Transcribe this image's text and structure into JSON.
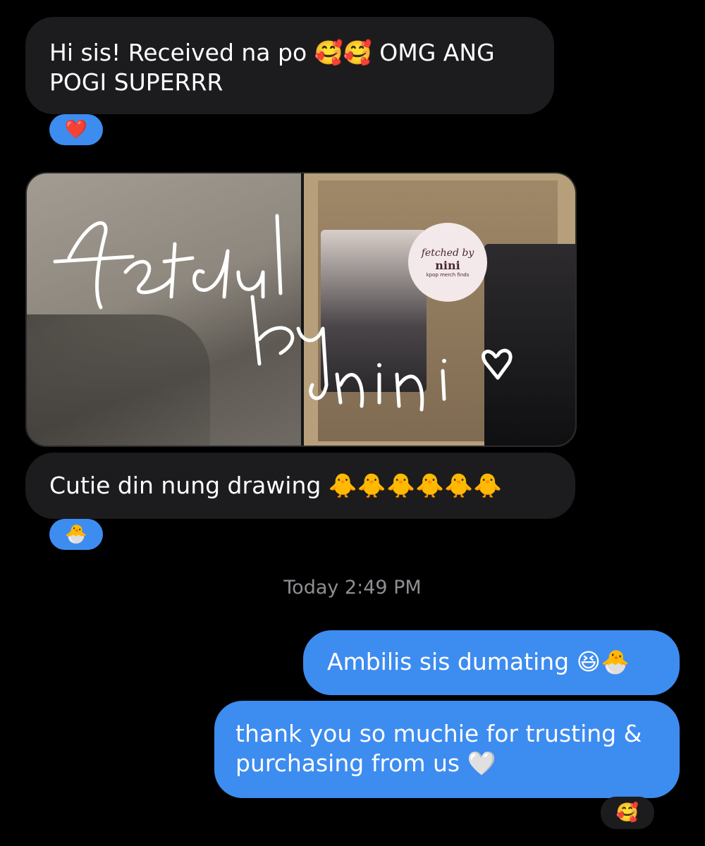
{
  "messages": {
    "m1_line1": "Hi sis! Received na po 🥰🥰 OMG ANG",
    "m1_line2": "POGI SUPERRR",
    "m1_reaction": "❤️",
    "m2_text": "Cutie din nung drawing 🐥🐥🐥🐥🐥🐥",
    "m2_reaction": "🐣",
    "timestamp": "Today 2:49 PM",
    "m3_text": "Ambilis sis dumating 😆🐣",
    "m4_line1": "thank you so muchie for trusting &",
    "m4_line2": "purchasing from us 🤍",
    "m4_reaction": "🥰"
  },
  "media": {
    "left_photo": "package-thank-you-note-photo",
    "right_photo": "photocards-package-photo",
    "logo_script": "fetched by",
    "logo_brand": "nini",
    "logo_tag": "kpop merch finds"
  }
}
